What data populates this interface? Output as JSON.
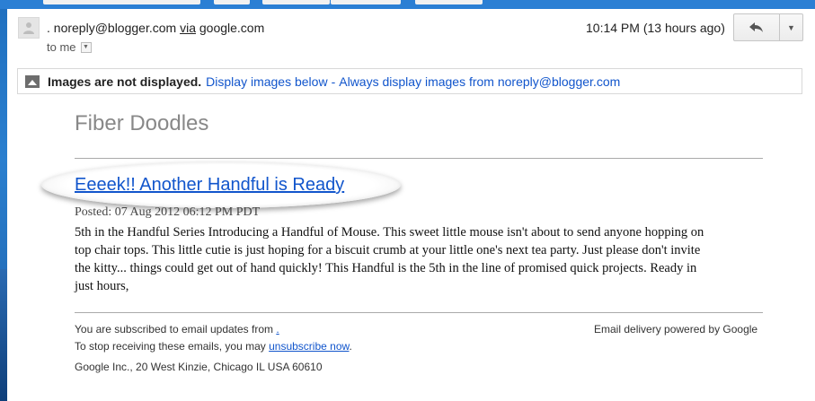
{
  "message": {
    "sender_name": ".",
    "sender_email": "noreply@blogger.com",
    "via_label": "via",
    "via_domain": "google.com",
    "to_label": "to me",
    "time": "10:14 PM (13 hours ago)"
  },
  "image_notice": {
    "bold": "Images are not displayed.",
    "display_below": "Display images below",
    "separator": "-",
    "always_display": "Always display images from noreply@blogger.com"
  },
  "content": {
    "blog_title": "Fiber Doodles",
    "post_title": "Eeeek!! Another Handful is Ready",
    "posted": "Posted: 07 Aug 2012 06:12 PM PDT",
    "lines": [
      "5th in the Handful Series Introducing a Handful of Mouse. This sweet little mouse isn't about to send anyone hopping on",
      "top chair tops. This little cutie is just hoping for a biscuit crumb at your little one's next tea party.  Just please don't invite",
      "the kitty... things could get out of hand quickly! This Handful is the 5th in the line of promised quick projects.   Ready in",
      "just hours,"
    ]
  },
  "footer": {
    "subscribed": "You are subscribed to email updates from",
    "subscribed_link": ".",
    "stop_text": "To stop receiving these emails, you may",
    "unsubscribe": "unsubscribe now",
    "period": ".",
    "address": "Google Inc., 20 West Kinzie, Chicago IL USA 60610",
    "powered": "Email delivery powered by Google"
  },
  "icons": {
    "avatar": "person-icon",
    "reply": "reply-arrow-icon",
    "more": "chevron-down-icon",
    "image": "image-icon"
  },
  "colors": {
    "link": "#1155cc",
    "title_gray": "#888888"
  }
}
